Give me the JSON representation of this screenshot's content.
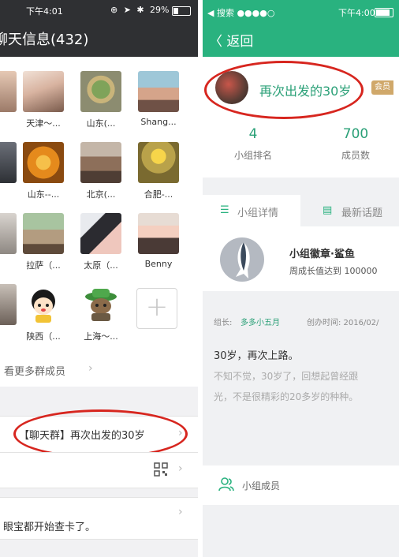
{
  "left": {
    "status": {
      "time": "下午4:01",
      "battery": "29%",
      "battery_fraction": 0.29,
      "icons": "⊕ ➤ ✱"
    },
    "title": "聊天信息(432)",
    "members": [
      {
        "name": "天津～...",
        "icon": "avatar-photo"
      },
      {
        "name": "山东(...",
        "icon": "avatar-photo"
      },
      {
        "name": "Shang...",
        "icon": "avatar-photo"
      },
      {
        "name": "山东--...",
        "icon": "avatar-photo"
      },
      {
        "name": "北京(...",
        "icon": "avatar-photo"
      },
      {
        "name": "合肥-...",
        "icon": "avatar-photo"
      },
      {
        "name": "拉萨（...",
        "icon": "avatar-photo"
      },
      {
        "name": "太原（...",
        "icon": "avatar-photo"
      },
      {
        "name": "Benny",
        "icon": "avatar-photo"
      },
      {
        "name": "陕西（...",
        "icon": "avatar-cartoon"
      },
      {
        "name": "上海～...",
        "icon": "avatar-cartoon"
      }
    ],
    "add_icon": "+",
    "more_members": "看更多群成员",
    "group_name": "【聊天群】再次出发的30岁",
    "notice": "眼宝都开始查卡了。",
    "highlight_color": "#d7261f"
  },
  "right": {
    "status": {
      "app_back": "◀ 搜索 ●●●●○",
      "time": "下午4:00",
      "battery_fraction": 0.85
    },
    "nav_back": "〈 返回",
    "group_title": "再次出发的30岁",
    "badge": "会员",
    "stats": [
      {
        "value": "4",
        "label": "小组排名"
      },
      {
        "value": "700",
        "label": "成员数"
      }
    ],
    "tabs": [
      {
        "label": "小组详情",
        "icon": "list-icon"
      },
      {
        "label": "最新话题",
        "icon": "chat-icon"
      }
    ],
    "badge_card": {
      "title": "小组徽章·鲨鱼",
      "subtitle": "周成长值达到 100000"
    },
    "leader_label": "组长: ",
    "leader_name": "多多小五月",
    "created_label": "创办时间: 2016/02/",
    "motto": "30岁，再次上路。",
    "description": [
      "不知不觉，30岁了，回想起曾经跟",
      "光，不是很精彩的20多岁的种种。"
    ],
    "members_label": "小组成员",
    "accent_color": "#29b27f"
  }
}
